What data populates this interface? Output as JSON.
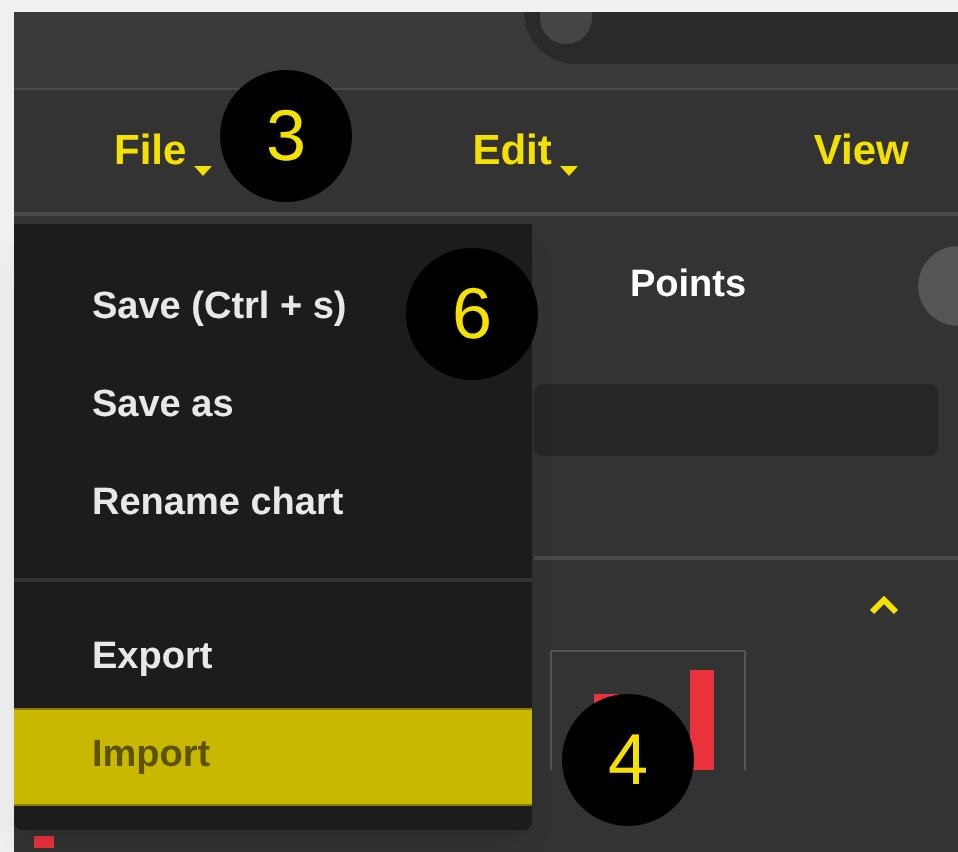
{
  "menu_bar": [
    {
      "label": "File",
      "caret": true
    },
    {
      "label": "Edit",
      "caret": true
    },
    {
      "label": "View",
      "caret": false
    }
  ],
  "tab": {
    "label": "Points"
  },
  "file_menu": {
    "groups": [
      [
        {
          "label": "Save (Ctrl + s)",
          "selected": false
        },
        {
          "label": "Save as",
          "selected": false
        },
        {
          "label": "Rename chart",
          "selected": false
        }
      ],
      [
        {
          "label": "Export",
          "selected": false
        },
        {
          "label": "Import",
          "selected": true
        }
      ]
    ]
  },
  "callouts": [
    {
      "number": "3"
    },
    {
      "number": "6"
    },
    {
      "number": "4"
    }
  ]
}
